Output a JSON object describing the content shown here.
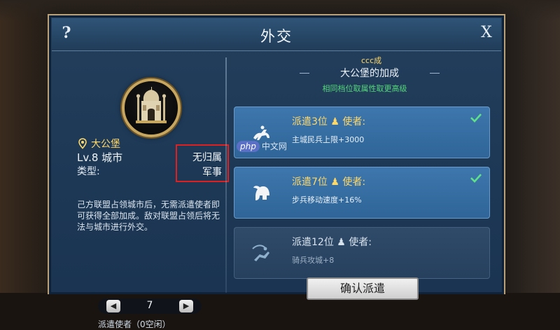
{
  "window": {
    "title": "外交",
    "help_label": "?",
    "close_label": "X"
  },
  "city": {
    "name": "大公堡",
    "level": "Lv.8 城市",
    "type_label": "类型:",
    "owner": "无归属",
    "owner_type": "军事",
    "description": "己方联盟占领城市后，无需派遣使者即可获得全部加成。敌对联盟占领后将无法与城市进行外交。"
  },
  "envoy": {
    "value": "7",
    "count_label": "派遣使者（0空闲）",
    "prev_icon": "left-arrow-icon",
    "next_icon": "right-arrow-icon"
  },
  "bonus": {
    "overlay_code": "ccc成",
    "title": "大公堡的加成",
    "subtitle": "相同档位取属性取更高级",
    "tiers": [
      {
        "title": "派遣3位",
        "title_suffix": "使者:",
        "effect": "主城民兵上限+3000",
        "active": true,
        "checked": true,
        "icon": "cavalry-icon"
      },
      {
        "title": "派遣7位",
        "title_suffix": "使者:",
        "effect": "步兵移动速度+16%",
        "active": true,
        "checked": true,
        "icon": "helmet-icon"
      },
      {
        "title": "派遣12位",
        "title_suffix": "使者:",
        "effect": "骑兵攻城+8",
        "active": false,
        "checked": false,
        "icon": "archer-icon"
      }
    ],
    "confirm_label": "确认派遣"
  },
  "watermark": {
    "brand": "php",
    "site": "中文网"
  },
  "colors": {
    "accent_gold": "#ffd86a",
    "active_tier": "#3e77ad",
    "highlight_green": "#55d87a",
    "annotation_red": "#e02020"
  }
}
